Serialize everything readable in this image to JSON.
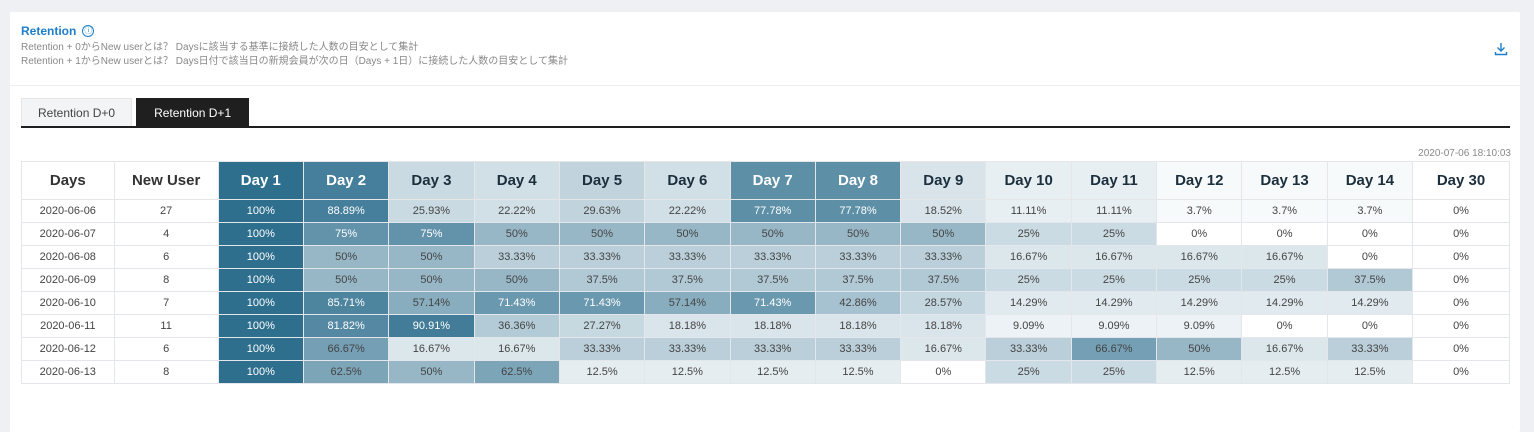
{
  "header": {
    "title": "Retention",
    "info_icon": "ⓘ",
    "desc_line1": "Retention + 0からNew userとは？ Daysに該当する基準に接続した人数の目安として集計",
    "desc_line2": "Retention + 1からNew userとは？ Days日付で該当日の新規会員が次の日（Days + 1日）に接続した人数の目安として集計"
  },
  "tabs": [
    "Retention D+0",
    "Retention D+1"
  ],
  "active_tab": 1,
  "timestamp": "2020-07-06 18:10:03",
  "colors": {
    "accent": "#1e7ec8",
    "heat_max": "#2f6f8e",
    "heat_min": "#ffffff"
  },
  "table": {
    "headers": [
      "Days",
      "New User",
      "Day 1",
      "Day 2",
      "Day 3",
      "Day 4",
      "Day 5",
      "Day 6",
      "Day 7",
      "Day 8",
      "Day 9",
      "Day 10",
      "Day 11",
      "Day 12",
      "Day 13",
      "Day 14",
      "Day 30"
    ],
    "rows": [
      [
        "2020-06-06",
        "27",
        "100%",
        "88.89%",
        "25.93%",
        "22.22%",
        "29.63%",
        "22.22%",
        "77.78%",
        "77.78%",
        "18.52%",
        "11.11%",
        "11.11%",
        "3.7%",
        "3.7%",
        "3.7%",
        "0%"
      ],
      [
        "2020-06-07",
        "4",
        "100%",
        "75%",
        "75%",
        "50%",
        "50%",
        "50%",
        "50%",
        "50%",
        "50%",
        "25%",
        "25%",
        "0%",
        "0%",
        "0%",
        "0%"
      ],
      [
        "2020-06-08",
        "6",
        "100%",
        "50%",
        "50%",
        "33.33%",
        "33.33%",
        "33.33%",
        "33.33%",
        "33.33%",
        "33.33%",
        "16.67%",
        "16.67%",
        "16.67%",
        "16.67%",
        "0%",
        "0%"
      ],
      [
        "2020-06-09",
        "8",
        "100%",
        "50%",
        "50%",
        "50%",
        "37.5%",
        "37.5%",
        "37.5%",
        "37.5%",
        "37.5%",
        "25%",
        "25%",
        "25%",
        "25%",
        "37.5%",
        "0%"
      ],
      [
        "2020-06-10",
        "7",
        "100%",
        "85.71%",
        "57.14%",
        "71.43%",
        "71.43%",
        "57.14%",
        "71.43%",
        "42.86%",
        "28.57%",
        "14.29%",
        "14.29%",
        "14.29%",
        "14.29%",
        "14.29%",
        "0%"
      ],
      [
        "2020-06-11",
        "11",
        "100%",
        "81.82%",
        "90.91%",
        "36.36%",
        "27.27%",
        "18.18%",
        "18.18%",
        "18.18%",
        "18.18%",
        "9.09%",
        "9.09%",
        "9.09%",
        "0%",
        "0%",
        "0%"
      ],
      [
        "2020-06-12",
        "6",
        "100%",
        "66.67%",
        "16.67%",
        "16.67%",
        "33.33%",
        "33.33%",
        "33.33%",
        "33.33%",
        "16.67%",
        "33.33%",
        "66.67%",
        "50%",
        "16.67%",
        "33.33%",
        "0%"
      ],
      [
        "2020-06-13",
        "8",
        "100%",
        "62.5%",
        "50%",
        "62.5%",
        "12.5%",
        "12.5%",
        "12.5%",
        "12.5%",
        "0%",
        "25%",
        "25%",
        "12.5%",
        "12.5%",
        "12.5%",
        "0%"
      ]
    ]
  }
}
